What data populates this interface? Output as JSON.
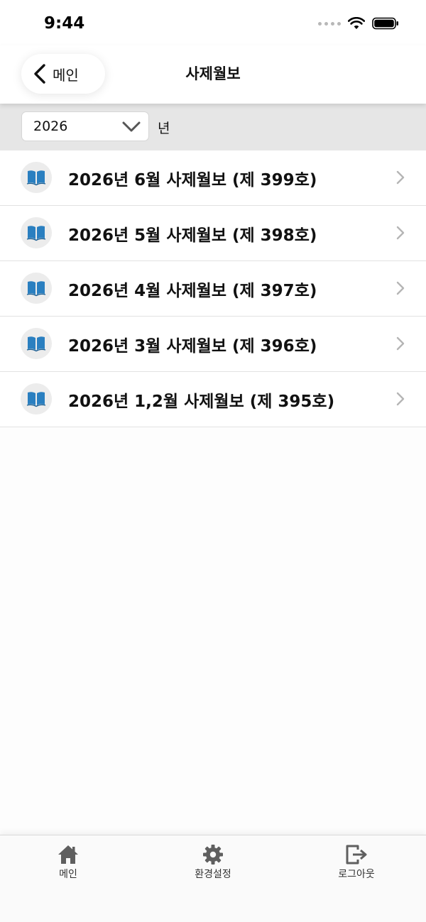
{
  "status_bar": {
    "time": "9:44"
  },
  "nav": {
    "back_label": "메인",
    "title": "사제월보"
  },
  "filter": {
    "year": "2026",
    "year_unit": "년"
  },
  "issues": [
    {
      "title": "2026년 6월 사제월보 (제 399호)",
      "icon": "book-icon"
    },
    {
      "title": "2026년 5월 사제월보 (제 398호)",
      "icon": "book-icon"
    },
    {
      "title": "2026년 4월 사제월보 (제 397호)",
      "icon": "book-icon"
    },
    {
      "title": "2026년 3월 사제월보 (제 396호)",
      "icon": "book-icon"
    },
    {
      "title": "2026년 1,2월 사제월보 (제 395호)",
      "icon": "book-icon"
    }
  ],
  "tab_bar": {
    "tabs": [
      {
        "label": "메인",
        "icon": "home-icon"
      },
      {
        "label": "환경설정",
        "icon": "gear-icon"
      },
      {
        "label": "로그아웃",
        "icon": "logout-icon"
      }
    ]
  },
  "colors": {
    "accent_icon": "#2a7fc0",
    "tab_icon": "#5f5f5f",
    "chevron": "#b5b5b5"
  }
}
